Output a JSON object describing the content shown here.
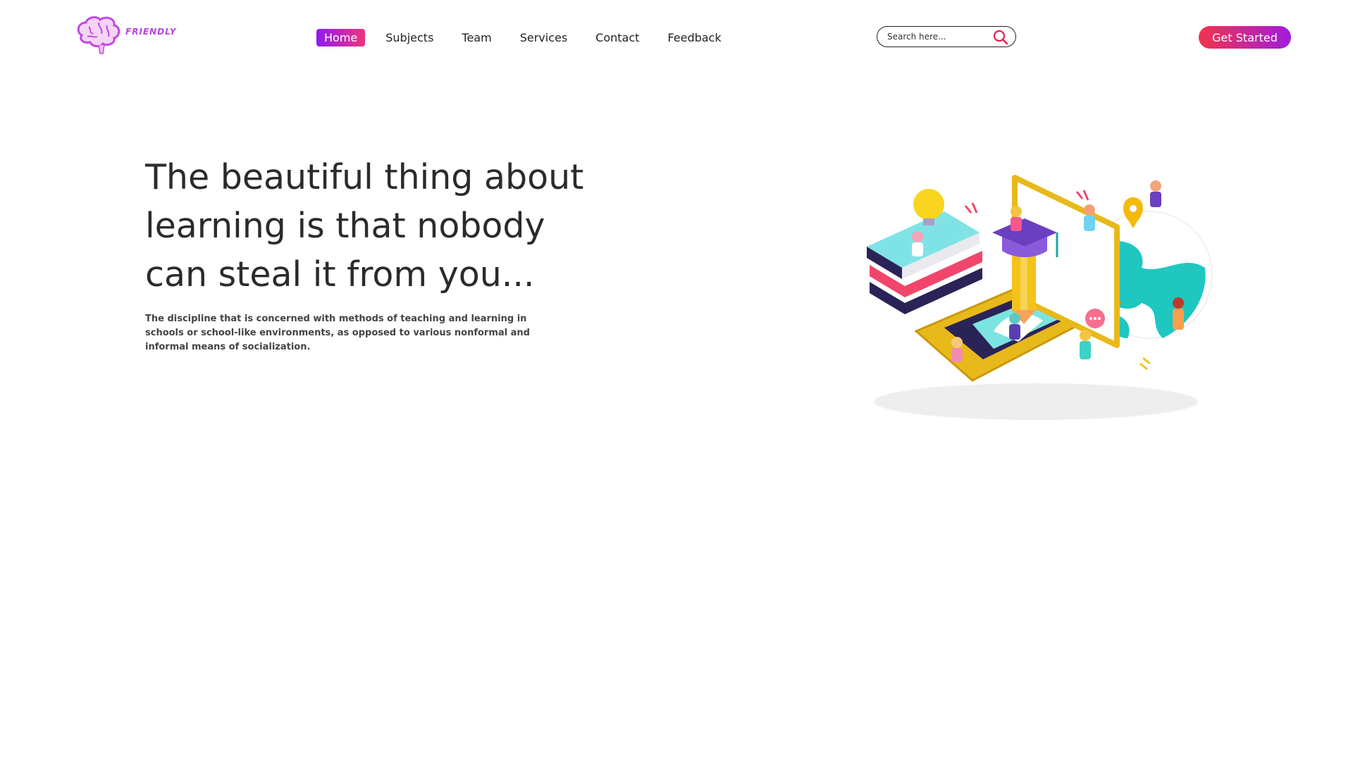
{
  "brand": {
    "logo_text": "FRIENDLY",
    "accent": "#b642e0"
  },
  "nav": {
    "items": [
      {
        "label": "Home",
        "active": true
      },
      {
        "label": "Subjects",
        "active": false
      },
      {
        "label": "Team",
        "active": false
      },
      {
        "label": "Services",
        "active": false
      },
      {
        "label": "Contact",
        "active": false
      },
      {
        "label": "Feedback",
        "active": false
      }
    ],
    "active_gradient": [
      "#8f1bf0",
      "#f0337d"
    ]
  },
  "search": {
    "placeholder": "Search here...",
    "value": "",
    "icon": "search-icon",
    "icon_color": "#e0234f"
  },
  "cta": {
    "label": "Get Started",
    "gradient": [
      "#f2334d",
      "#a11bdc"
    ]
  },
  "hero": {
    "headline": "The beautiful thing about learning is that nobody can steal it from you...",
    "subtext": "The discipline that is concerned with methods of teaching and learning in schools or school-like environments, as opposed to various nonformal and informal means of socialization.",
    "illustration": "isometric-education-illustration"
  }
}
